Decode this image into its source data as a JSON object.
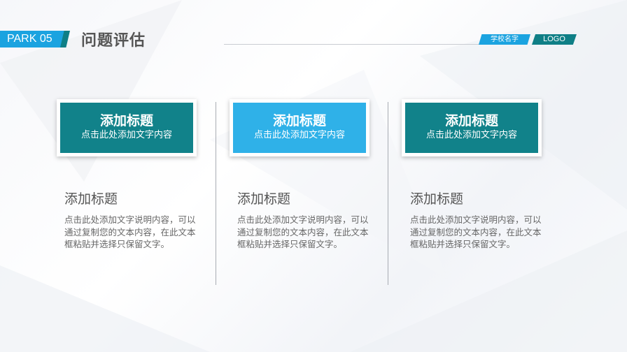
{
  "header": {
    "park_label": "PARK 05",
    "title": "问题评估",
    "school_name": "学校名字",
    "logo_text": "LOGO"
  },
  "colors": {
    "accent_blue": "#1ba3e0",
    "accent_teal": "#0f7f86",
    "text_gray": "#555555"
  },
  "cards": [
    {
      "title": "添加标题",
      "subtitle": "点击此处添加文字内容",
      "color": "#11828a"
    },
    {
      "title": "添加标题",
      "subtitle": "点击此处添加文字内容",
      "color": "#2fb1e8"
    },
    {
      "title": "添加标题",
      "subtitle": "点击此处添加文字内容",
      "color": "#11828a"
    }
  ],
  "columns": [
    {
      "heading": "添加标题",
      "body": "点击此处添加文字说明内容，可以通过复制您的文本内容，在此文本框粘贴并选择只保留文字。"
    },
    {
      "heading": "添加标题",
      "body": "点击此处添加文字说明内容，可以通过复制您的文本内容，在此文本框粘贴并选择只保留文字。"
    },
    {
      "heading": "添加标题",
      "body": "点击此处添加文字说明内容，可以通过复制您的文本内容，在此文本框粘贴并选择只保留文字。"
    }
  ]
}
